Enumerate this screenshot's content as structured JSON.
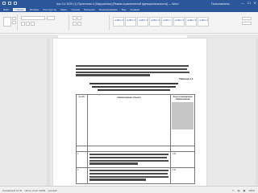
{
  "window": {
    "title": "doc 0.4 2020 (1) Проектная 4 (Нарушения) [Режим ограниченной функциональности] — Word",
    "user": "Пользователь",
    "controls": [
      "—",
      "☐",
      "✕"
    ]
  },
  "ribbon": {
    "tabs": [
      "Файл",
      "Главная",
      "Вставка",
      "Конструктор",
      "Макет",
      "Ссылки",
      "Рассылки",
      "Рецензирование",
      "Вид",
      "Справка"
    ],
    "active_tab": "Главная",
    "styles": [
      "AaBbCcDd",
      "AaBbCcDd",
      "AaBbCcDd",
      "AaBbCcDd",
      "AaBbCc",
      "AaBbCcDd",
      "AaBbCcDd",
      "AaBbCcDd"
    ]
  },
  "document": {
    "caption": "Таблица 1.1",
    "table": {
      "header_num": "№ п/п",
      "header_name": "Наименование объекта",
      "header_code": "Код и сокращённое наименование",
      "rows": [
        {
          "num": "1",
          "value": "1.21"
        },
        {
          "num": "2",
          "value": "1.21"
        }
      ]
    }
  },
  "statusbar": {
    "page": "Страница 8 из 42",
    "words": "Число слов: 11063",
    "lang": "русский",
    "zoom": "100%"
  },
  "colors": {
    "accent": "#2b579a",
    "highlight": "#c6c6c6"
  }
}
